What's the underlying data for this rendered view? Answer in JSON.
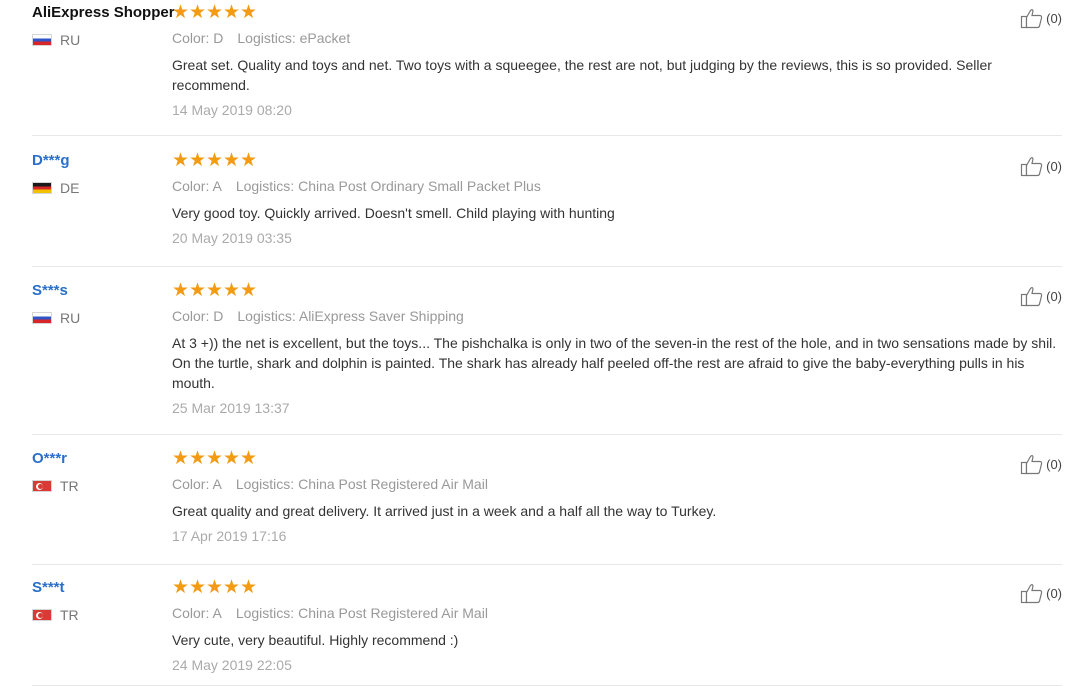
{
  "reviews": [
    {
      "name": "AliExpress Shopper",
      "country": "RU",
      "flag_colors": [
        "#ffffff",
        "#2f55c8",
        "#d62828"
      ],
      "rating": 5,
      "color_label": "Color:",
      "color_value": "D",
      "logistics_label": "Logistics:",
      "logistics_value": "ePacket",
      "text": "Great set. Quality and toys and net. Two toys with a squeegee, the rest are not, but judging by the reviews, this is so provided. Seller recommend.",
      "date": "14 May 2019 08:20",
      "helpful": "(0)"
    },
    {
      "name": "D***g",
      "country": "DE",
      "flag_colors": [
        "#1a1a1a",
        "#d62828",
        "#f2c200"
      ],
      "rating": 5,
      "color_label": "Color:",
      "color_value": "A",
      "logistics_label": "Logistics:",
      "logistics_value": "China Post Ordinary Small Packet Plus",
      "text": "Very good toy. Quickly arrived. Doesn't smell. Child playing with hunting",
      "date": "20 May 2019 03:35",
      "helpful": "(0)"
    },
    {
      "name": "S***s",
      "country": "RU",
      "flag_colors": [
        "#ffffff",
        "#2f55c8",
        "#d62828"
      ],
      "rating": 5,
      "color_label": "Color:",
      "color_value": "D",
      "logistics_label": "Logistics:",
      "logistics_value": "AliExpress Saver Shipping",
      "text": "At 3 +)) the net is excellent, but the toys... The pishchalka is only in two of the seven-in the rest of the hole, and in two sensations made by shil. On the turtle, shark and dolphin is painted. The shark has already half peeled off-the rest are afraid to give the baby-everything pulls in his mouth.",
      "date": "25 Mar 2019 13:37",
      "helpful": "(0)"
    },
    {
      "name": "O***r",
      "country": "TR",
      "flag_colors": [
        "#d93a35",
        "#ffffff"
      ],
      "rating": 5,
      "color_label": "Color:",
      "color_value": "A",
      "logistics_label": "Logistics:",
      "logistics_value": "China Post Registered Air Mail",
      "text": "Great quality and great delivery. It arrived just in a week and a half all the way to Turkey.",
      "date": "17 Apr 2019 17:16",
      "helpful": "(0)"
    },
    {
      "name": "S***t",
      "country": "TR",
      "flag_colors": [
        "#d93a35",
        "#ffffff"
      ],
      "rating": 5,
      "color_label": "Color:",
      "color_value": "A",
      "logistics_label": "Logistics:",
      "logistics_value": "China Post Registered Air Mail",
      "text": "Very cute, very beautiful. Highly recommend :)",
      "date": "24 May 2019 22:05",
      "helpful": "(0)"
    }
  ],
  "icons": {
    "star": "star-icon",
    "thumb": "thumbs-up-icon",
    "flag": "country-flag-icon"
  },
  "colors": {
    "star": "#f39b12",
    "masked_name": "#2a6fc9",
    "plain_name": "#111111",
    "muted": "#999999",
    "date": "#aaaaaa",
    "divider": "#e8e8e8"
  }
}
